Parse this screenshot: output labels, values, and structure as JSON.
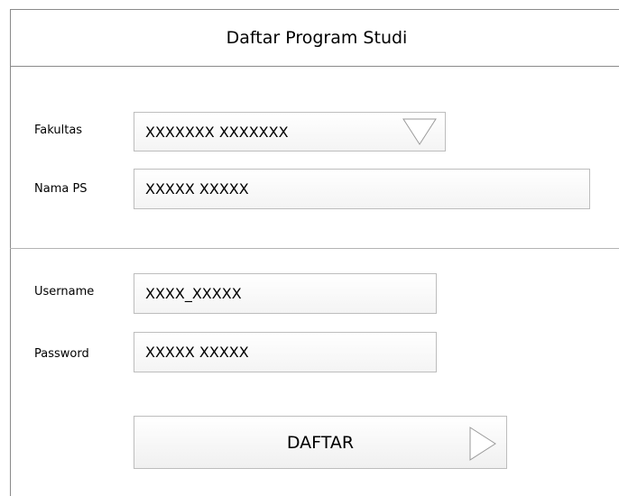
{
  "header": {
    "title": "Daftar Program Studi"
  },
  "program": {
    "fakultas_label": "Fakultas",
    "fakultas_value": "XXXXXXX XXXXXXX",
    "nama_ps_label": "Nama PS",
    "nama_ps_value": "XXXXX XXXXX"
  },
  "account": {
    "username_label": "Username",
    "username_value": "XXXX_XXXXX",
    "password_label": "Password",
    "password_value": "XXXXX XXXXX"
  },
  "actions": {
    "submit_label": "DAFTAR"
  },
  "icons": {
    "dropdown": "triangle-down-icon",
    "submit": "triangle-right-icon"
  }
}
